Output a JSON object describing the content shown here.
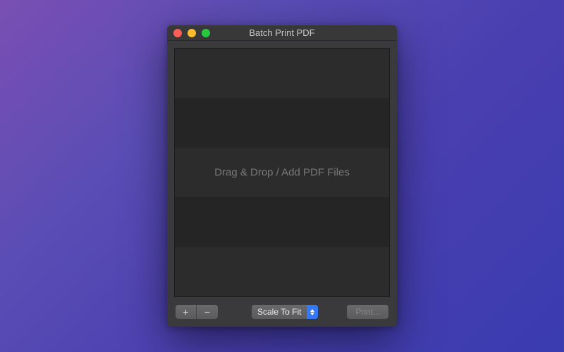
{
  "window": {
    "title": "Batch Print PDF"
  },
  "dropzone": {
    "placeholder": "Drag & Drop / Add PDF Files"
  },
  "toolbar": {
    "add_icon": "+",
    "remove_icon": "−",
    "scale_mode": {
      "selected": "Scale To Fit"
    },
    "print_label": "Print..."
  }
}
